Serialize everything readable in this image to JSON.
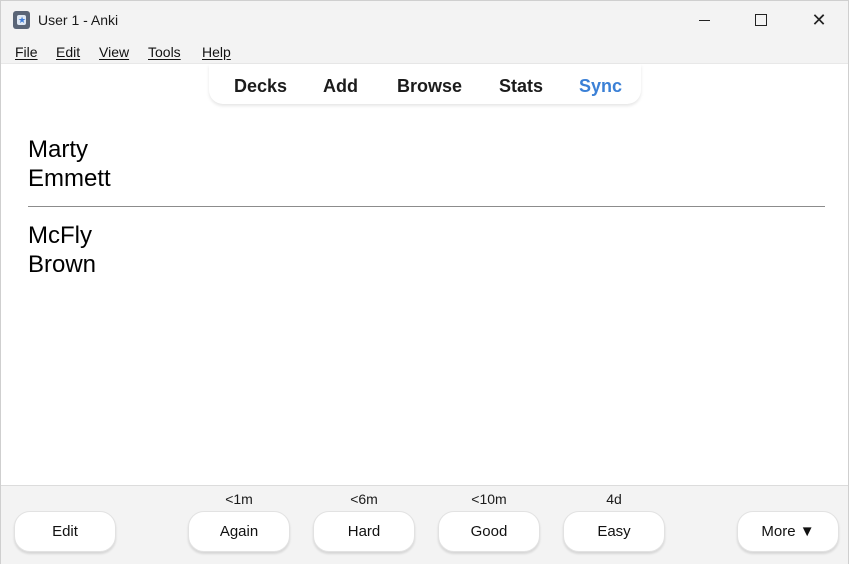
{
  "window": {
    "title": "User 1 - Anki"
  },
  "menu": [
    "File",
    "Edit",
    "View",
    "Tools",
    "Help"
  ],
  "nav": [
    "Decks",
    "Add",
    "Browse",
    "Stats",
    "Sync"
  ],
  "card": {
    "front": [
      "Marty",
      "Emmett"
    ],
    "back": [
      "McFly",
      "Brown"
    ]
  },
  "bottom": {
    "edit_label": "Edit",
    "more_label": "More ▼",
    "answers": [
      {
        "interval": "<1m",
        "label": "Again"
      },
      {
        "interval": "<6m",
        "label": "Hard"
      },
      {
        "interval": "<10m",
        "label": "Good"
      },
      {
        "interval": "4d",
        "label": "Easy"
      }
    ]
  },
  "colors": {
    "sync_accent": "#3b80d6",
    "chrome": "#f3f3f3"
  }
}
